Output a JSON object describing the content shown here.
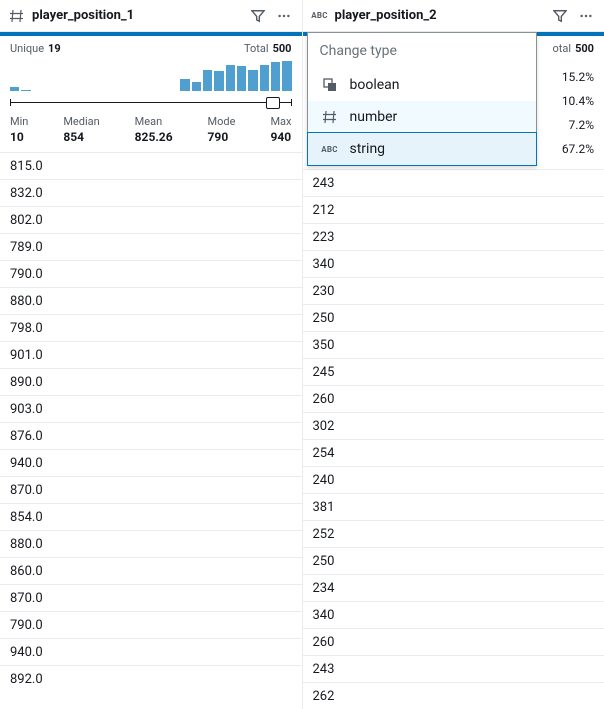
{
  "columns": [
    {
      "type_icon": "number",
      "title": "player_position_1",
      "unique_label": "Unique",
      "unique_value": "19",
      "total_label": "Total",
      "total_value": "500",
      "histogram": [
        3,
        1,
        0,
        0,
        0,
        0,
        0,
        0,
        0,
        0,
        0,
        0,
        0,
        0,
        0,
        10,
        7,
        17,
        16,
        21,
        20,
        17,
        21,
        23,
        24
      ],
      "summary": {
        "min_label": "Min",
        "min": "10",
        "median_label": "Median",
        "median": "854",
        "mean_label": "Mean",
        "mean": "825.26",
        "mode_label": "Mode",
        "mode": "790",
        "max_label": "Max",
        "max": "940"
      },
      "rows": [
        "815.0",
        "832.0",
        "802.0",
        "789.0",
        "790.0",
        "880.0",
        "798.0",
        "901.0",
        "890.0",
        "903.0",
        "876.0",
        "940.0",
        "870.0",
        "854.0",
        "880.0",
        "860.0",
        "870.0",
        "790.0",
        "940.0",
        "892.0"
      ]
    },
    {
      "type_icon": "string",
      "title": "player_position_2",
      "total_label": "otal",
      "total_value": "500",
      "percents": [
        "15.2%",
        "10.4%",
        "7.2%",
        "67.2%"
      ],
      "rows": [
        "243",
        "212",
        "223",
        "340",
        "230",
        "250",
        "350",
        "245",
        "260",
        "302",
        "254",
        "240",
        "381",
        "252",
        "250",
        "234",
        "340",
        "260",
        "243",
        "262"
      ]
    }
  ],
  "dropdown": {
    "title": "Change type",
    "items": [
      {
        "icon": "boolean",
        "label": "boolean"
      },
      {
        "icon": "number",
        "label": "number"
      },
      {
        "icon": "string",
        "label": "string"
      }
    ]
  }
}
